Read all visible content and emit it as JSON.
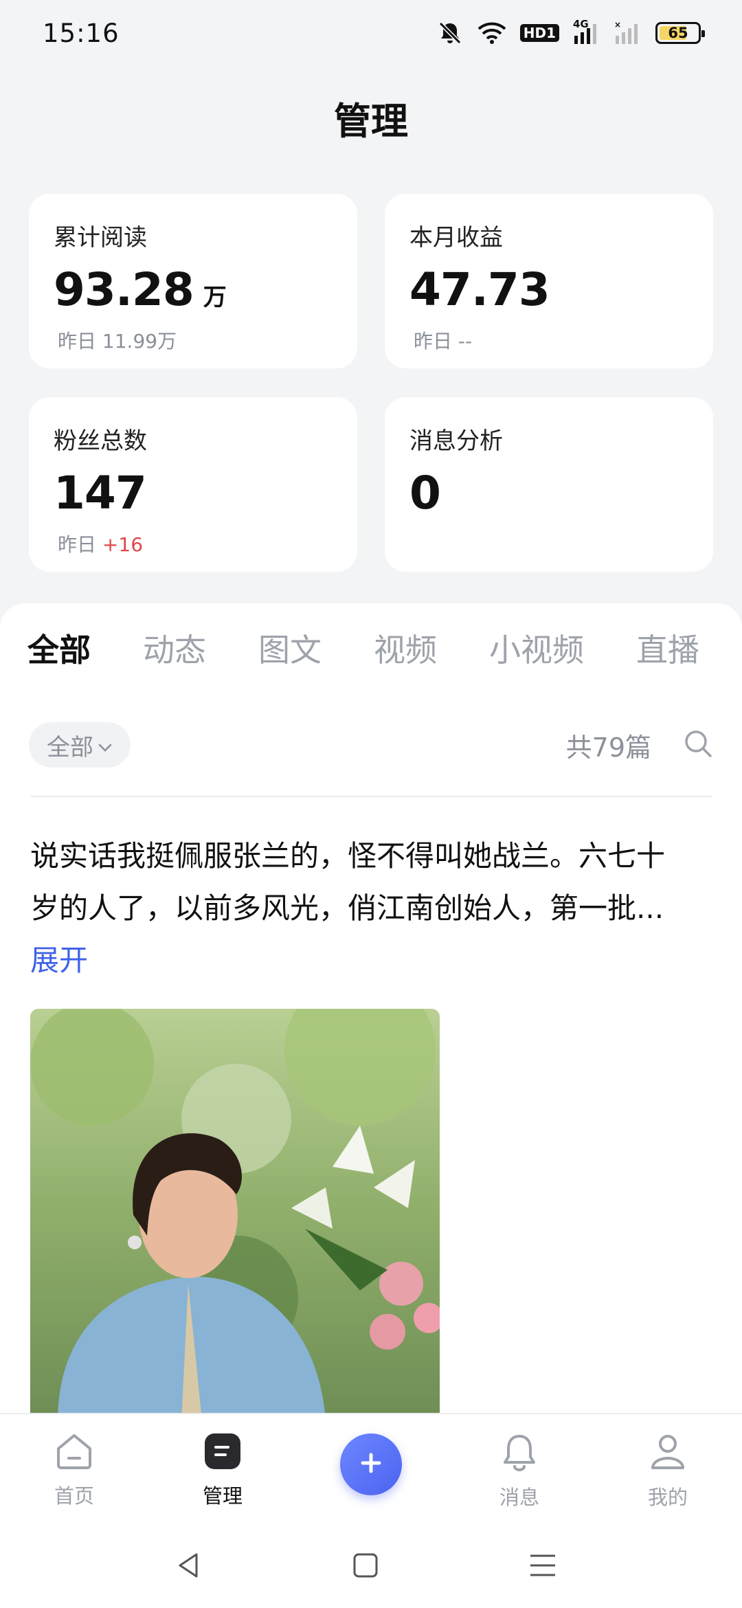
{
  "status_bar": {
    "time": "15:16",
    "hd_label": "HD1",
    "network_label": "4G",
    "battery_level": "65",
    "icons": [
      "mute-icon",
      "wifi-icon",
      "hd-icon",
      "signal-4g-icon",
      "signal-icon",
      "battery-icon"
    ]
  },
  "header": {
    "title": "管理"
  },
  "stats": {
    "reads": {
      "label": "累计阅读",
      "value": "93.28",
      "unit": "万",
      "sub_prefix": "昨日",
      "sub_value": "11.99万"
    },
    "earnings": {
      "label": "本月收益",
      "value": "47.73",
      "sub_prefix": "昨日",
      "sub_value": "--"
    },
    "fans": {
      "label": "粉丝总数",
      "value": "147",
      "sub_prefix": "昨日",
      "sub_value": "+16"
    },
    "messages": {
      "label": "消息分析",
      "value": "0"
    }
  },
  "tabs": [
    {
      "label": "全部",
      "active": true
    },
    {
      "label": "动态"
    },
    {
      "label": "图文"
    },
    {
      "label": "视频"
    },
    {
      "label": "小视频"
    },
    {
      "label": "直播"
    }
  ],
  "filter": {
    "selected": "全部",
    "count_text": "共79篇"
  },
  "post": {
    "text": "说实话我挺佩服张兰的，怪不得叫她战兰。六七十岁的人了，以前多风光，俏江南创始人，第一批...",
    "expand_label": "展开"
  },
  "bottom_nav": [
    {
      "label": "首页",
      "icon": "home-icon"
    },
    {
      "label": "管理",
      "icon": "manage-icon",
      "active": true
    },
    {
      "label": "",
      "icon": "plus-icon"
    },
    {
      "label": "消息",
      "icon": "bell-icon"
    },
    {
      "label": "我的",
      "icon": "profile-icon"
    }
  ],
  "colors": {
    "accent": "#4c64f0",
    "link": "#3f62e8",
    "delta_positive": "#e0464a",
    "background": "#f3f4f6"
  }
}
